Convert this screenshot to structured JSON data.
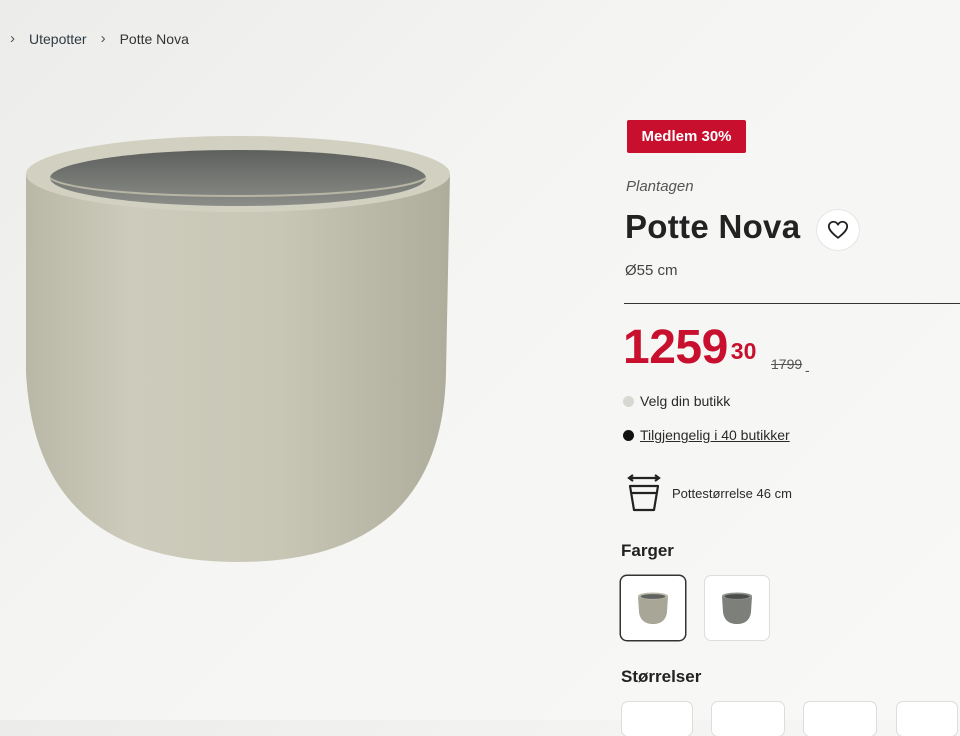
{
  "breadcrumb": {
    "items": [
      {
        "label": "Utepotter"
      },
      {
        "label": "Potte Nova"
      }
    ]
  },
  "product": {
    "badge": "Medlem 30%",
    "brand": "Plantagen",
    "title": "Potte Nova",
    "size_label": "Ø55 cm",
    "price_main": "1259",
    "price_cents": "30",
    "old_price": "1799",
    "old_price_suffix": "-",
    "store_select": "Velg din butikk",
    "availability": "Tilgjengelig i 40 butikker",
    "pot_size_info": "Pottestørrelse 46 cm"
  },
  "colors": {
    "accent_red": "#c8102e",
    "pot_beige": "#cac8b8",
    "pot_grey": "#8a8b86"
  },
  "sections": {
    "colors_heading": "Farger",
    "sizes_heading": "Størrelser"
  },
  "swatches": [
    {
      "name": "beige",
      "selected": true
    },
    {
      "name": "grey",
      "selected": false
    }
  ],
  "icons": {
    "favorite": "heart-outline-icon",
    "pot_size": "pot-size-icon"
  }
}
